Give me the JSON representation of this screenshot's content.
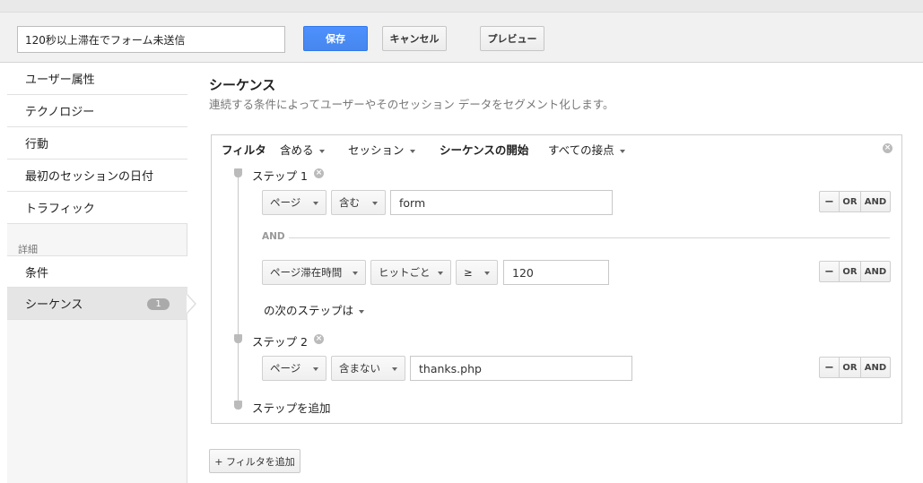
{
  "header": {
    "segment_name": "120秒以上滞在でフォーム未送信",
    "save_label": "保存",
    "cancel_label": "キャンセル",
    "preview_label": "プレビュー"
  },
  "sidebar": {
    "items": [
      {
        "label": "ユーザー属性"
      },
      {
        "label": "テクノロジー"
      },
      {
        "label": "行動"
      },
      {
        "label": "最初のセッションの日付"
      },
      {
        "label": "トラフィック"
      }
    ],
    "section_label": "詳細",
    "advanced_items": [
      {
        "label": "条件"
      },
      {
        "label": "シーケンス",
        "badge": "1"
      }
    ]
  },
  "main": {
    "title": "シーケンス",
    "description": "連続する条件によってユーザーやそのセッション データをセグメント化します。"
  },
  "filter": {
    "filter_label": "フィルタ",
    "include_value": "含める",
    "scope_value": "セッション",
    "sequence_start_label": "シーケンスの開始",
    "sequence_start_value": "すべての接点",
    "steps": [
      {
        "label": "ステップ 1",
        "conditions": [
          {
            "dimension": "ページ",
            "operator": "含む",
            "value": "form"
          },
          {
            "dimension": "ページ滞在時間",
            "scope": "ヒットごと",
            "operator": "≥",
            "value": "120"
          }
        ],
        "and_label": "AND",
        "next_step_label": "の次のステップは"
      },
      {
        "label": "ステップ 2",
        "conditions": [
          {
            "dimension": "ページ",
            "operator": "含まない",
            "value": "thanks.php"
          }
        ]
      }
    ],
    "add_step_label": "ステップを追加",
    "row_buttons": {
      "minus": "−",
      "or": "OR",
      "and": "AND"
    }
  },
  "add_filter_label": "+ フィルタを追加"
}
